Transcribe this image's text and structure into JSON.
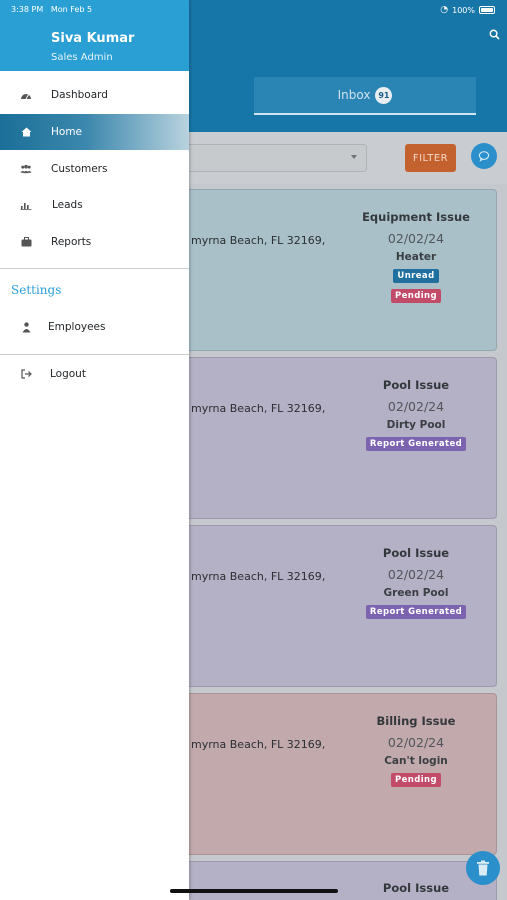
{
  "status_bar": {
    "time": "3:38 PM",
    "date": "Mon Feb 5",
    "battery": "100%"
  },
  "drawer": {
    "user_name": "Siva Kumar",
    "user_role": "Sales Admin",
    "items": [
      {
        "label": "Dashboard",
        "icon": "dashboard-icon"
      },
      {
        "label": "Home",
        "icon": "home-icon",
        "active": true
      },
      {
        "label": "Customers",
        "icon": "users-icon"
      },
      {
        "label": "Leads",
        "icon": "chart-icon"
      },
      {
        "label": "Reports",
        "icon": "briefcase-icon"
      }
    ],
    "settings_title": "Settings",
    "settings_items": [
      {
        "label": "Employees",
        "icon": "user-icon"
      }
    ],
    "logout_label": "Logout"
  },
  "header": {
    "inbox_label": "Inbox",
    "inbox_count": "91"
  },
  "toolbar": {
    "filter_label": "FILTER"
  },
  "tickets": [
    {
      "address": "myrna Beach, FL 32169,",
      "issue": "Equipment Issue",
      "date": "02/02/24",
      "subtype": "Heater",
      "tags": [
        "Unread",
        "Pending"
      ],
      "bg": "#a9c0c9"
    },
    {
      "address": "myrna Beach, FL 32169,",
      "issue": "Pool Issue",
      "date": "02/02/24",
      "subtype": "Dirty Pool",
      "tags": [
        "Report Generated"
      ],
      "bg": "#b4b0c5"
    },
    {
      "address": "myrna Beach, FL 32169,",
      "issue": "Pool Issue",
      "date": "02/02/24",
      "subtype": "Green Pool",
      "tags": [
        "Report Generated"
      ],
      "bg": "#b4b0c5"
    },
    {
      "address": "myrna Beach, FL 32169,",
      "issue": "Billing Issue",
      "date": "02/02/24",
      "subtype": "Can't login",
      "tags": [
        "Pending"
      ],
      "bg": "#c2a9ac"
    },
    {
      "issue": "Pool Issue",
      "bg": "#b4b0c5"
    }
  ],
  "colors": {
    "header": "#1776a8",
    "drawer_header": "#2a9fd3",
    "accent_filter": "#c3622e",
    "fab": "#2b8fcb"
  }
}
